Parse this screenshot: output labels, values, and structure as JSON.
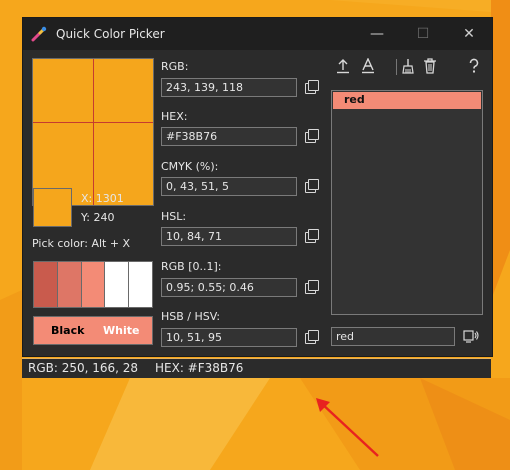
{
  "window": {
    "title": "Quick Color Picker"
  },
  "picker": {
    "x_label": "X: 1301",
    "y_label": "Y: 240",
    "pick_hint": "Pick color: Alt + X",
    "shades": [
      "#c95b4d",
      "#de7666",
      "#f38b76",
      "#ffffff",
      "#ffffff"
    ],
    "contrast_black": "Black",
    "contrast_white": "White"
  },
  "fields": [
    {
      "label": "RGB:",
      "value": "243, 139, 118"
    },
    {
      "label": "HEX:",
      "value": "#F38B76"
    },
    {
      "label": "CMYK (%):",
      "value": "0, 43, 51, 5"
    },
    {
      "label": "HSL:",
      "value": "10, 84, 71"
    },
    {
      "label": "RGB [0..1]:",
      "value": "0.95; 0.55; 0.46"
    },
    {
      "label": "HSB / HSV:",
      "value": "10, 51, 95"
    }
  ],
  "toolbar": {
    "export_icon": "upload-icon",
    "font_icon": "font-icon",
    "clean_icon": "broom-icon",
    "delete_icon": "trash-icon",
    "help_icon": "help-icon"
  },
  "colors_list": {
    "items": [
      "red"
    ],
    "search_value": "red"
  },
  "status": {
    "rgb": "RGB: 250, 166, 28",
    "hex": "HEX: #F38B76"
  },
  "palette": {
    "accent": "#f38b76",
    "picked": "#f5a61c",
    "crosshair": "#c63b2f",
    "arrow": "#e8231f"
  }
}
